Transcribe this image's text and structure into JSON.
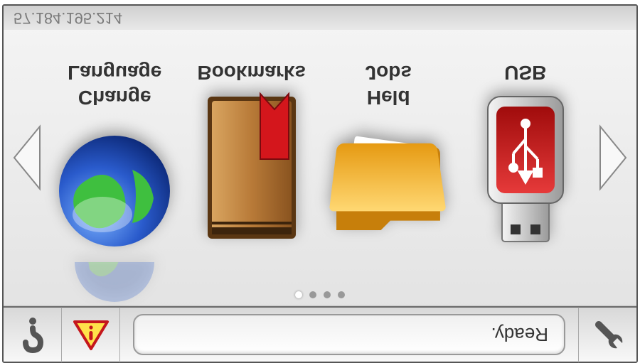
{
  "status": {
    "text": "Ready."
  },
  "pager": {
    "total": 4,
    "active": 0
  },
  "apps": [
    {
      "label": "Change\nLanguage",
      "icon": "globe"
    },
    {
      "label": "Bookmarks",
      "icon": "bookmark"
    },
    {
      "label": "Held\nJobs",
      "icon": "folder"
    },
    {
      "label": "USB",
      "icon": "usb"
    }
  ],
  "footer": {
    "ip": "57.184.195.214"
  }
}
